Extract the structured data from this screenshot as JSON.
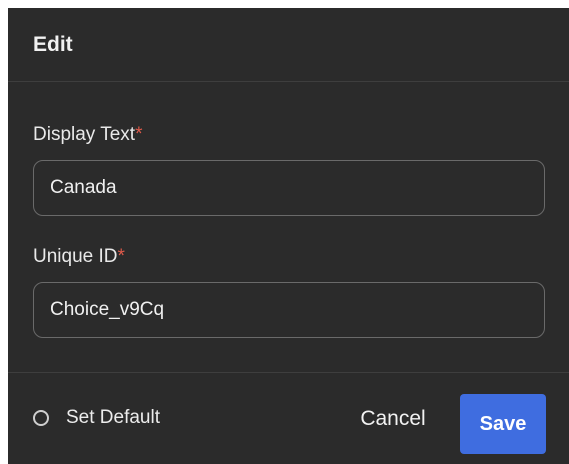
{
  "dialog": {
    "title": "Edit",
    "fields": [
      {
        "label": "Display Text",
        "required_mark": "*",
        "value": "Canada"
      },
      {
        "label": "Unique ID",
        "required_mark": "*",
        "value": "Choice_v9Cq"
      }
    ],
    "set_default_label": "Set Default",
    "set_default_checked": false,
    "cancel_label": "Cancel",
    "save_label": "Save"
  },
  "colors": {
    "background": "#2b2b2b",
    "accent": "#3f6de0",
    "required": "#e05a4a"
  }
}
